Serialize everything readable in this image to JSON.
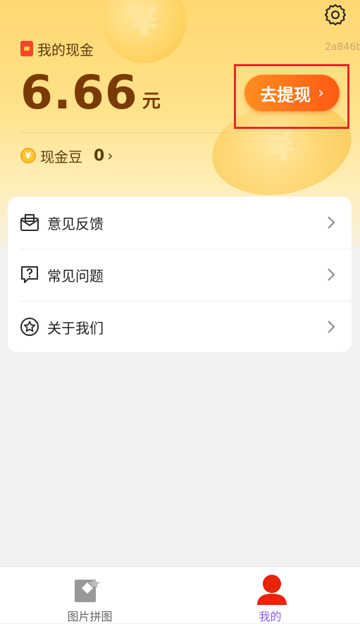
{
  "header": {
    "cash_label": "我的现金",
    "user_id": "2a846b",
    "amount": "6.66",
    "amount_unit": "元",
    "withdraw_label": "去提现",
    "beans_label": "现金豆",
    "beans_value": "0"
  },
  "menu": {
    "items": [
      {
        "label": "意见反馈",
        "icon": "mail-icon"
      },
      {
        "label": "常见问题",
        "icon": "question-bubble-icon"
      },
      {
        "label": "关于我们",
        "icon": "star-circle-icon"
      }
    ]
  },
  "tabbar": {
    "tabs": [
      {
        "label": "图片拼图",
        "icon": "puzzle-image-icon",
        "active": false
      },
      {
        "label": "我的",
        "icon": "user-icon",
        "active": true
      }
    ]
  },
  "colors": {
    "accent_orange": "#ff6a16",
    "active_tab": "#8a5cf6",
    "inactive_tab": "#666666",
    "highlight_frame": "#e9262a"
  }
}
